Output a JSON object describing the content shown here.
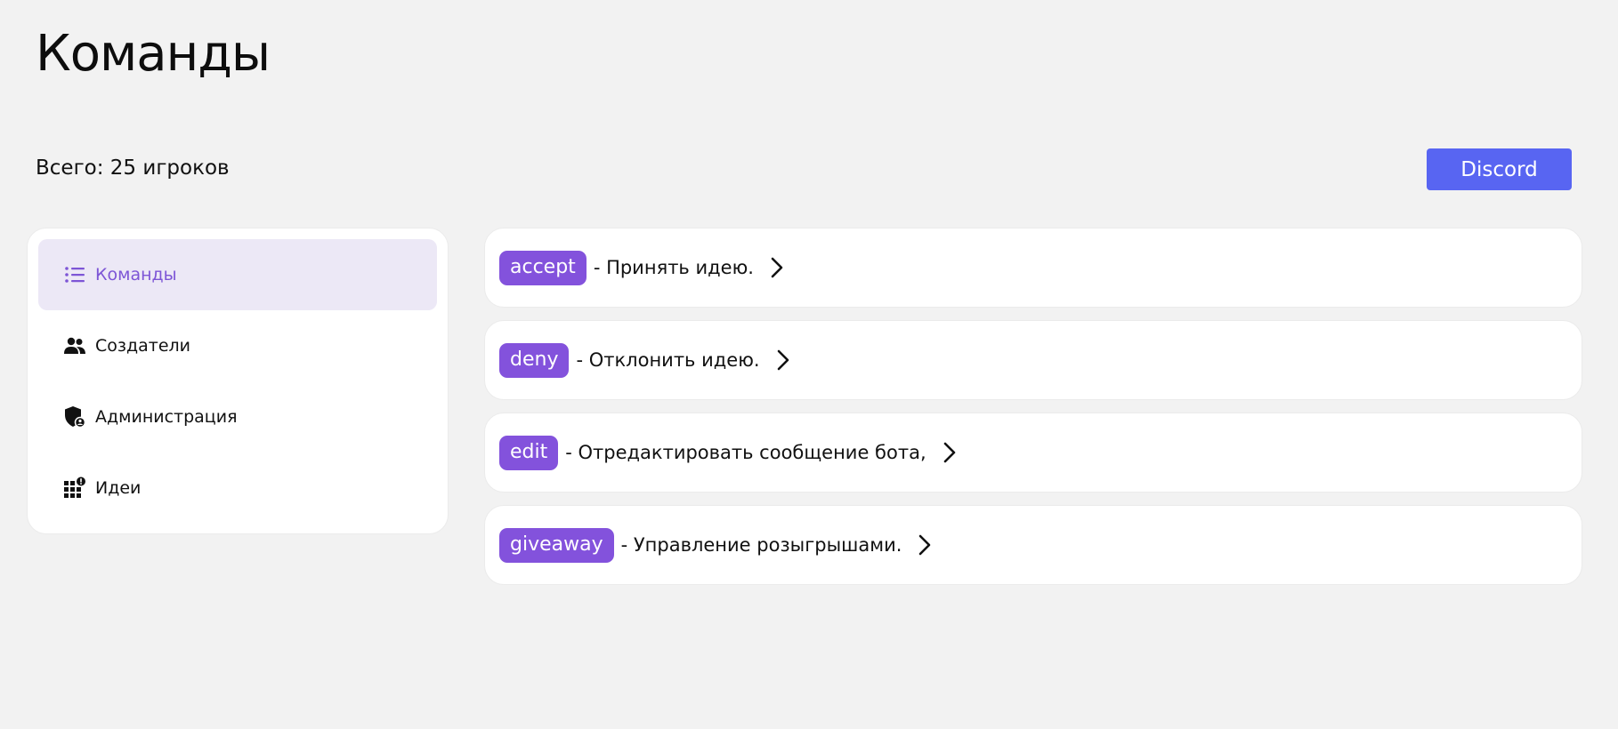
{
  "page": {
    "title": "Команды"
  },
  "summary": {
    "text": "Всего: 25 игроков"
  },
  "header": {
    "discord_label": "Discord"
  },
  "colors": {
    "accent": "#8352dc",
    "discord": "#5865f2",
    "active_bg": "#ece8f6",
    "background": "#f2f2f2"
  },
  "sidebar": {
    "items": [
      {
        "label": "Команды",
        "icon": "list-icon",
        "active": true
      },
      {
        "label": "Создатели",
        "icon": "people-icon",
        "active": false
      },
      {
        "label": "Администрация",
        "icon": "shield-icon",
        "active": false
      },
      {
        "label": "Идеи",
        "icon": "grid-alert-icon",
        "active": false
      }
    ]
  },
  "commands": [
    {
      "name": "accept",
      "description": "- Принять идею."
    },
    {
      "name": "deny",
      "description": "- Отклонить идею."
    },
    {
      "name": "edit",
      "description": "- Отредактировать сообщение бота,"
    },
    {
      "name": "giveaway",
      "description": "- Управление розыгрышами."
    }
  ]
}
